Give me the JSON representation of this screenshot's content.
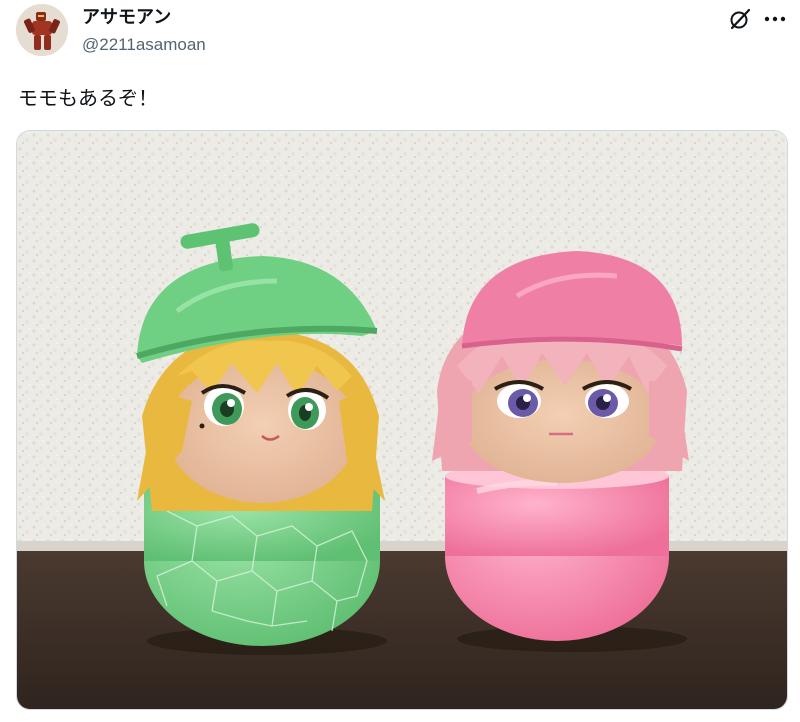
{
  "tweet": {
    "author": {
      "display_name": "アサモアン",
      "handle": "@2211asamoan",
      "avatar_icon": "avatar-robot-figure"
    },
    "text": "モモもあるぞ！",
    "header_icons": [
      "grok-icon",
      "more-options-icon"
    ],
    "media": {
      "icon": "photo-two-plush-capsule-figures"
    }
  },
  "colors": {
    "text_primary": "#0f1419",
    "text_secondary": "#536471",
    "melon_green": "#7fcf8c",
    "peach_pink": "#f07fa6"
  }
}
